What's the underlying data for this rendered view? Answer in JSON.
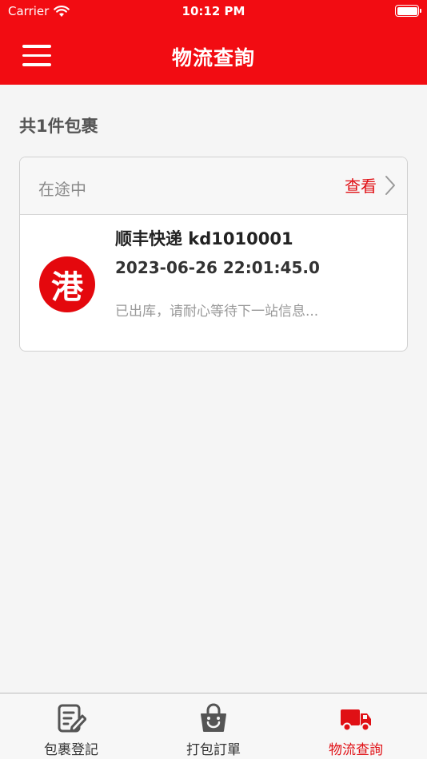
{
  "status_bar": {
    "carrier": "Carrier",
    "time": "10:12 PM"
  },
  "nav": {
    "title": "物流查詢"
  },
  "summary": {
    "count_label": "共1件包裹"
  },
  "package": {
    "status": "在途中",
    "view_label": "查看",
    "logo_char": "港",
    "courier": "顺丰快递 kd1010001",
    "datetime": "2023-06-26 22:01:45.0",
    "message": "已出库，请耐心等待下一站信息..."
  },
  "tabs": [
    {
      "label": "包裹登記",
      "icon": "form-edit-icon",
      "active": false
    },
    {
      "label": "打包訂單",
      "icon": "shopping-bag-icon",
      "active": false
    },
    {
      "label": "物流查詢",
      "icon": "truck-icon",
      "active": true
    }
  ],
  "colors": {
    "brand": "#f20c12",
    "accent_text": "#e01015",
    "background": "#f5f5f5"
  }
}
